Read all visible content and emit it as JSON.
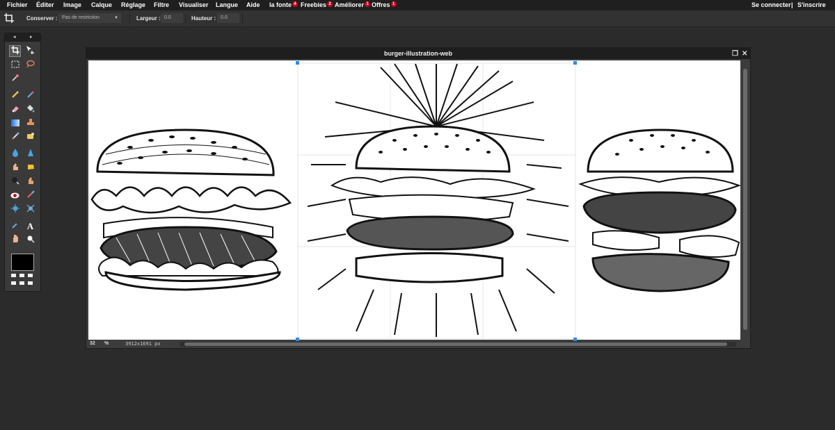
{
  "menubar": {
    "items": [
      {
        "label": "Fichier"
      },
      {
        "label": "Éditer"
      },
      {
        "label": "Image"
      },
      {
        "label": "Calque"
      },
      {
        "label": "Réglage"
      },
      {
        "label": "Filtre"
      },
      {
        "label": "Visualiser"
      },
      {
        "label": "Langue"
      },
      {
        "label": "Aide"
      },
      {
        "label": "la fonte",
        "badge": "4"
      },
      {
        "label": "Freebies",
        "badge": "2"
      },
      {
        "label": "Améliorer",
        "badge": "1"
      },
      {
        "label": "Offres",
        "badge": "1"
      }
    ],
    "login": "Se connecter",
    "divider": "|",
    "register": "S'inscrire"
  },
  "options": {
    "keep_label": "Conserver :",
    "keep_value": "Pas de restriction",
    "width_label": "Largeur :",
    "width_value": "0.0",
    "height_label": "Hauteur :",
    "height_value": "0.0"
  },
  "toolpanel": {
    "arrow_left": "◂",
    "arrow_right": "▸",
    "foreground_color": "#000000"
  },
  "document": {
    "title": "burger-illustration-web",
    "zoom": "32",
    "zoom_unit": "%",
    "dimensions": "3912x1691 px"
  },
  "icons": {
    "crop": "crop-icon",
    "move": "move-icon",
    "marquee": "marquee-icon",
    "lasso": "lasso-icon",
    "wand": "magic-wand-icon",
    "pencil": "pencil-icon",
    "brush": "brush-icon",
    "eraser": "eraser-icon",
    "bucket": "paint-bucket-icon",
    "gradient": "gradient-icon",
    "stamp": "clone-stamp-icon",
    "heal": "healing-icon",
    "patch": "patch-icon",
    "drop": "blur-icon",
    "sharpen": "sharpen-icon",
    "smudge": "smudge-icon",
    "sponge": "sponge-icon",
    "burn": "burn-icon",
    "dodge": "dodge-icon",
    "redeye": "red-eye-icon",
    "replace": "color-replace-icon",
    "bloat": "bloat-icon",
    "pinch": "pinch-icon",
    "picker": "color-picker-icon",
    "text": "text-icon",
    "hand": "hand-icon",
    "zoom": "zoom-icon"
  },
  "colors": {
    "menubar_bg": "#1f1f1f",
    "workspace_bg": "#2b2b2b",
    "selection_handle": "#2b8be6",
    "badge": "#d0021b"
  }
}
